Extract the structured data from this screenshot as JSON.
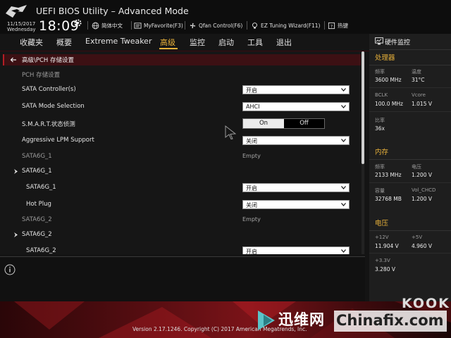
{
  "header": {
    "title": "UEFI BIOS Utility – Advanced Mode",
    "date": "11/15/2017",
    "weekday": "Wednesday",
    "time": "18:09",
    "tools": {
      "language": "简体中文",
      "myfavorite": "MyFavorite(F3)",
      "qfan": "Qfan Control(F6)",
      "ez_tuning": "EZ Tuning Wizard(F11)",
      "hotkeys": "热键"
    }
  },
  "nav": {
    "tabs": [
      "收藏夹",
      "概要",
      "Extreme Tweaker",
      "高级",
      "监控",
      "启动",
      "工具",
      "退出"
    ],
    "active_index": 3
  },
  "main": {
    "breadcrumb": "高级\\PCH 存储设置",
    "section_title": "PCH 存储设置",
    "rows": [
      {
        "label": "SATA Controller(s)",
        "value": "开启"
      },
      {
        "label": "SATA Mode Selection",
        "value": "AHCI"
      },
      {
        "label": "S.M.A.R.T.状态侦测",
        "toggle_on": "On",
        "toggle_off": "Off"
      },
      {
        "label": "Aggressive LPM Support",
        "value": "关闭"
      },
      {
        "label": "SATA6G_1",
        "value": "Empty"
      },
      {
        "label": "SATA6G_1"
      },
      {
        "label": "SATA6G_1",
        "value": "开启"
      },
      {
        "label": "Hot Plug",
        "value": "关闭"
      },
      {
        "label": "SATA6G_2",
        "value": "Empty"
      },
      {
        "label": "SATA6G_2"
      },
      {
        "label": "SATA6G_2",
        "value": "开启"
      }
    ]
  },
  "hw": {
    "title": "硬件监控",
    "processor": {
      "title": "处理器",
      "freq_label": "频率",
      "freq": "3600 MHz",
      "temp_label": "温度",
      "temp": "31°C",
      "bclk_label": "BCLK",
      "bclk": "100.0 MHz",
      "vcore_label": "Vcore",
      "vcore": "1.015 V",
      "ratio_label": "比率",
      "ratio": "36x"
    },
    "memory": {
      "title": "内存",
      "freq_label": "频率",
      "freq": "2133 MHz",
      "volt_label": "电压",
      "volt": "1.200 V",
      "cap_label": "容量",
      "cap": "32768 MB",
      "vol_chcd_label": "Vol_CHCD",
      "vol_chcd": "1.200 V"
    },
    "voltage": {
      "title": "电压",
      "v12_label": "+12V",
      "v12": "11.904 V",
      "v5_label": "+5V",
      "v5": "4.960 V",
      "v33_label": "+3.3V",
      "v33": "3.280 V"
    }
  },
  "footer": {
    "version": "Version 2.17.1246. Copyright (C) 2017 American Megatrends, Inc."
  },
  "watermark": {
    "cn": "迅维网",
    "site": "Chinafix.com",
    "kook": "KOOK"
  },
  "colors": {
    "accent": "#e8b13a",
    "brand_red": "#b51e25",
    "panel": "#1e1e1e"
  }
}
